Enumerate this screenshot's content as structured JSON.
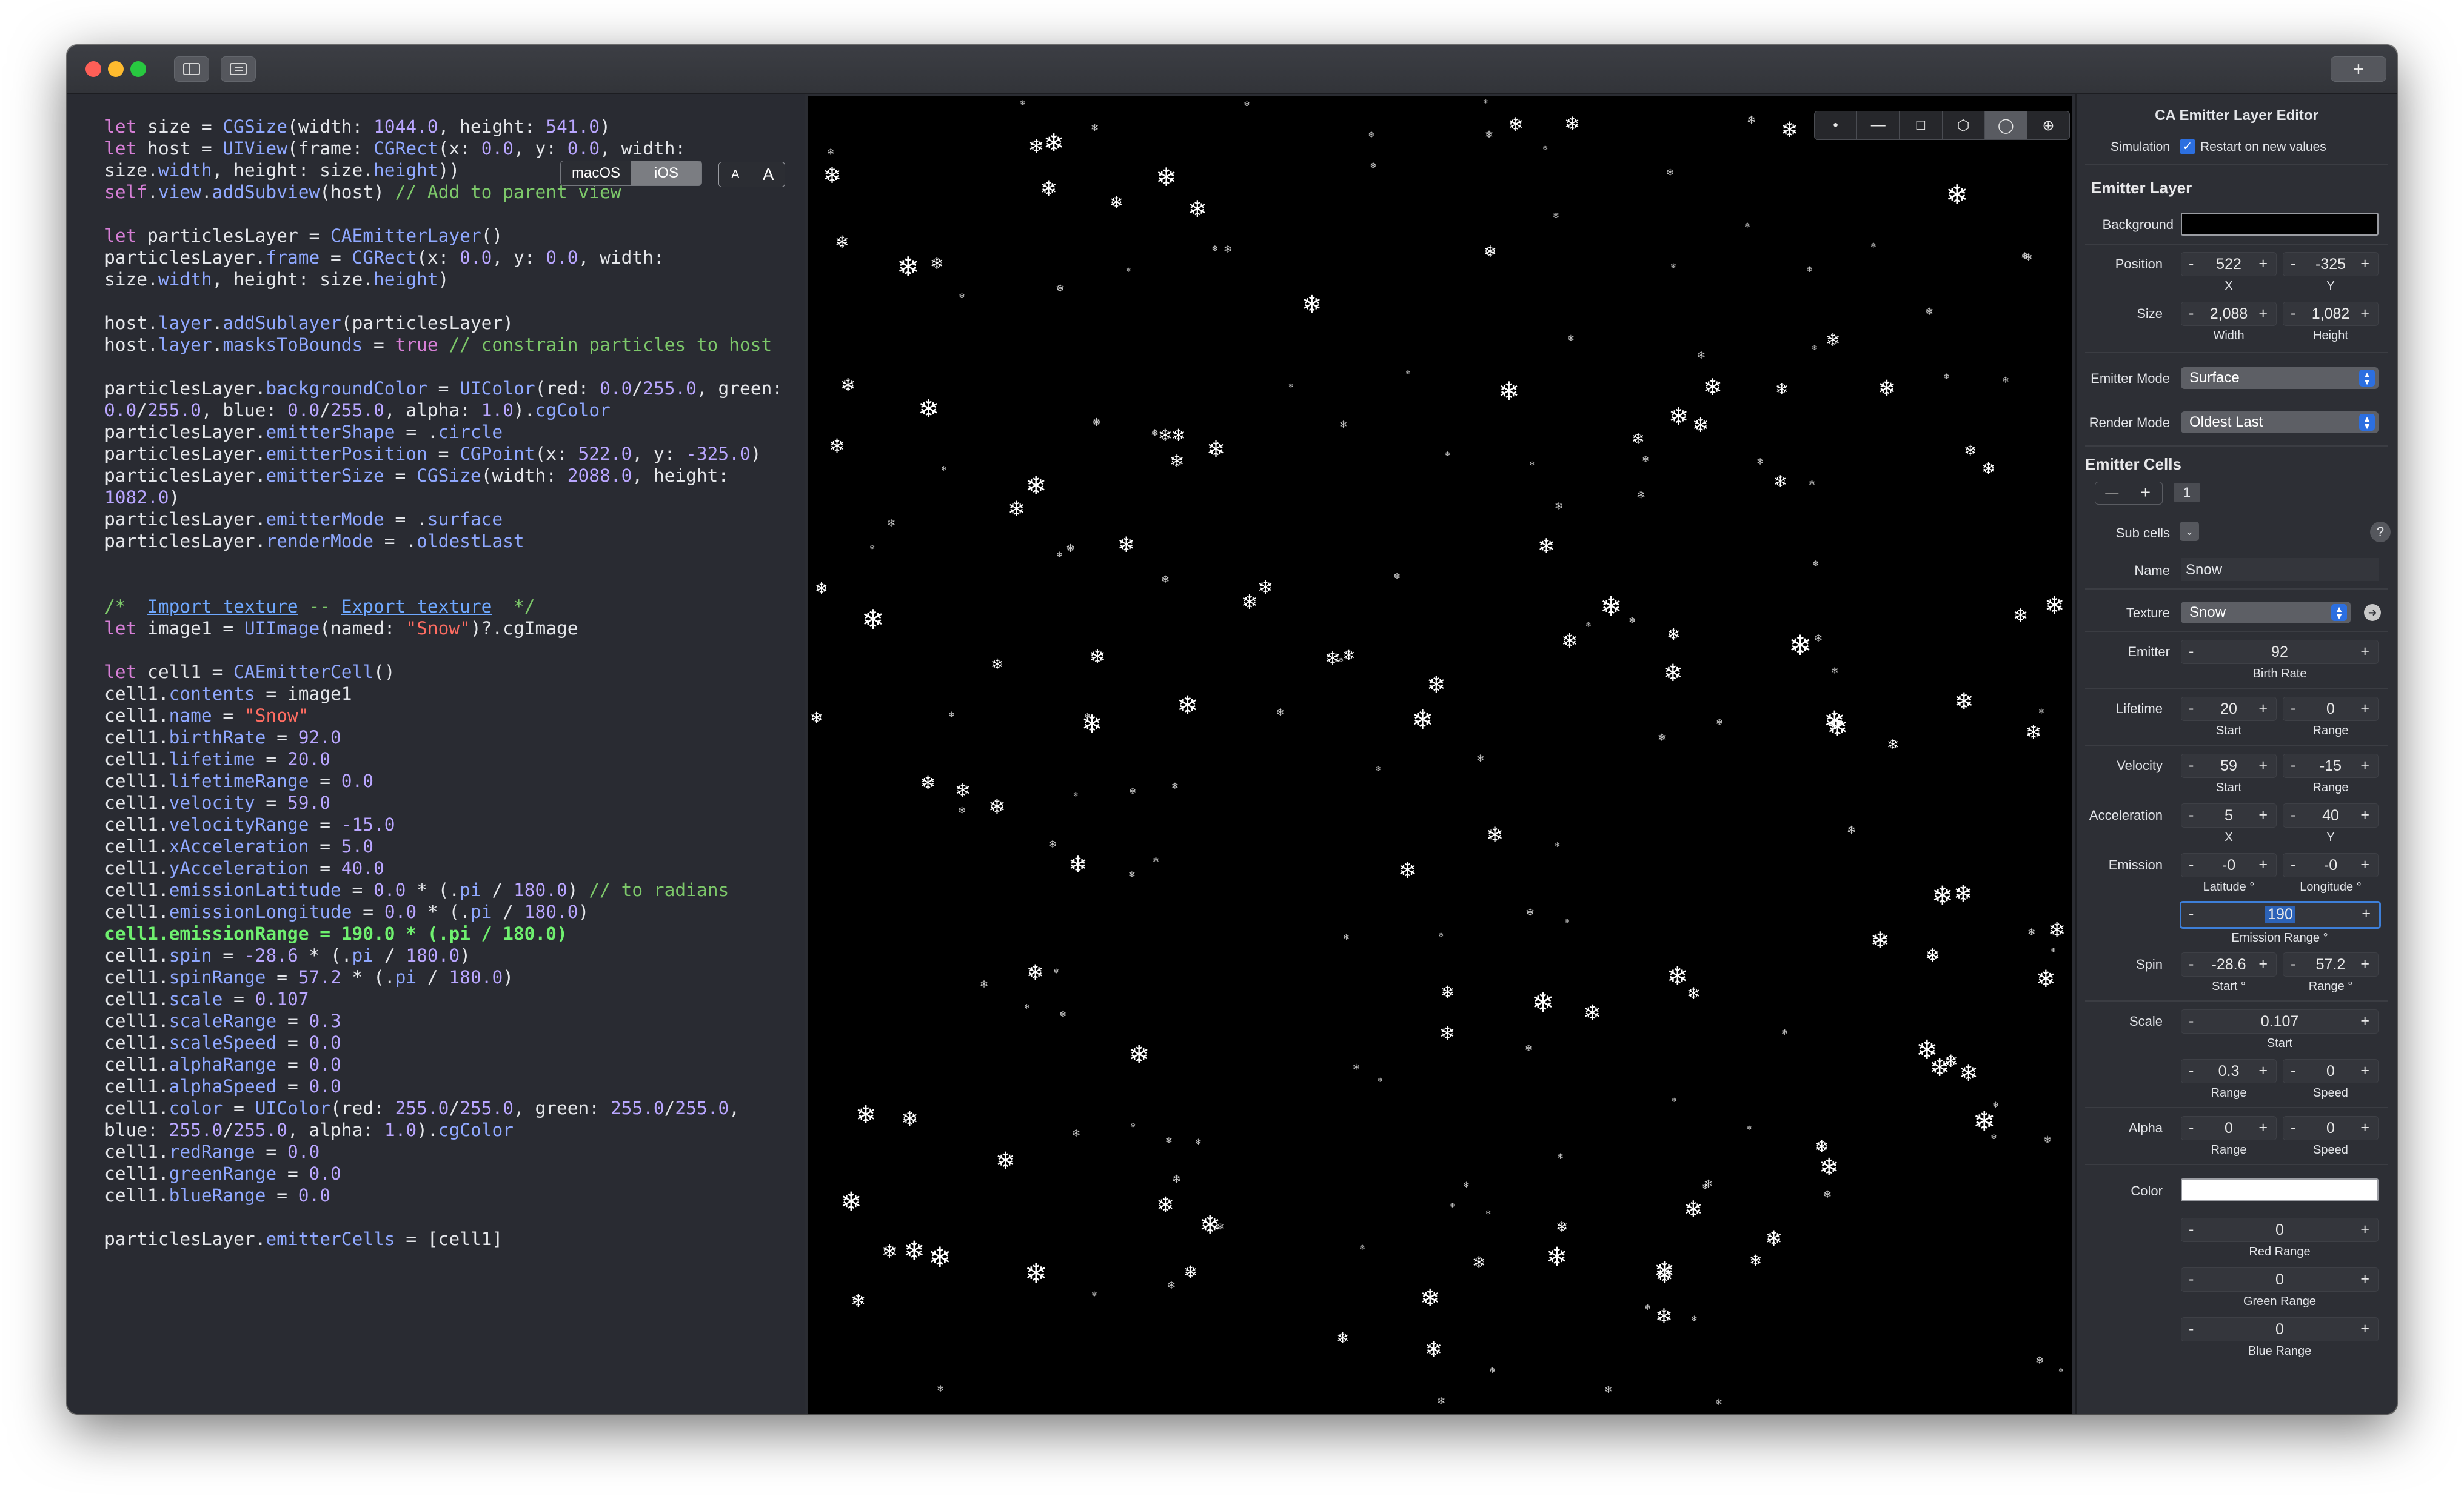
{
  "window": {
    "traffic_lights": {
      "close": "#fe5f57",
      "minimize": "#febb2e",
      "zoom": "#28c840"
    },
    "toolbar": {
      "sidebar_icon": "sidebar-icon",
      "list_icon": "list-icon",
      "add_label": "+"
    }
  },
  "code_pane": {
    "platform_options": [
      "macOS",
      "iOS"
    ],
    "platform_selected": "iOS",
    "font_buttons": [
      "A",
      "A"
    ]
  },
  "preview": {
    "background": "#000000",
    "view_modes": [
      "point",
      "line",
      "rectangle",
      "cuboid",
      "circle",
      "sphere"
    ],
    "view_mode_icons": [
      "•",
      "—",
      "□",
      "⬡",
      "◯",
      "⊕"
    ],
    "selected_mode": "circle",
    "particle_glyph": "❄"
  },
  "inspector": {
    "title": "CA Emitter Layer Editor",
    "simulation_label": "Simulation",
    "restart_label": "Restart on new values",
    "restart_checked": true,
    "emitter_layer_header": "Emitter Layer",
    "background_label": "Background",
    "background_color": "#000000",
    "position_label": "Position",
    "position_x": "522",
    "position_y": "-325",
    "x_label": "X",
    "y_label": "Y",
    "size_label": "Size",
    "size_width": "2,088",
    "size_height": "1,082",
    "width_label": "Width",
    "height_label": "Height",
    "emitter_mode_label": "Emitter Mode",
    "emitter_mode": "Surface",
    "render_mode_label": "Render Mode",
    "render_mode": "Oldest Last",
    "emitter_cells_header": "Emitter Cells",
    "cell_minus": "—",
    "cell_plus": "+",
    "cell_count": "1",
    "sub_cells_label": "Sub cells",
    "help": "?",
    "name_label": "Name",
    "name_value": "Snow",
    "texture_label": "Texture",
    "texture_value": "Snow",
    "emitter_label": "Emitter",
    "birth_rate": "92",
    "birth_rate_label": "Birth Rate",
    "lifetime_label": "Lifetime",
    "lifetime_start": "20",
    "lifetime_range": "0",
    "start_label": "Start",
    "range_label": "Range",
    "velocity_label": "Velocity",
    "velocity_start": "59",
    "velocity_range": "-15",
    "acceleration_label": "Acceleration",
    "accel_x": "5",
    "accel_y": "40",
    "emission_label": "Emission",
    "emission_latitude": "-0",
    "emission_longitude": "-0",
    "latitude_label": "Latitude °",
    "longitude_label": "Longitude °",
    "emission_range": "190",
    "emission_range_label": "Emission Range °",
    "spin_label": "Spin",
    "spin_start": "-28.6",
    "spin_range": "57.2",
    "spin_start_label": "Start °",
    "spin_range_label": "Range °",
    "scale_label": "Scale",
    "scale_start": "0.107",
    "scale_range": "0.3",
    "scale_speed": "0",
    "speed_label": "Speed",
    "alpha_label": "Alpha",
    "alpha_range": "0",
    "alpha_speed": "0",
    "color_label": "Color",
    "cell_color": "#ffffff",
    "red_range": "0",
    "red_range_label": "Red Range",
    "green_range": "0",
    "green_range_label": "Green Range",
    "blue_range": "0",
    "blue_range_label": "Blue Range",
    "minus": "-",
    "plus": "+"
  }
}
